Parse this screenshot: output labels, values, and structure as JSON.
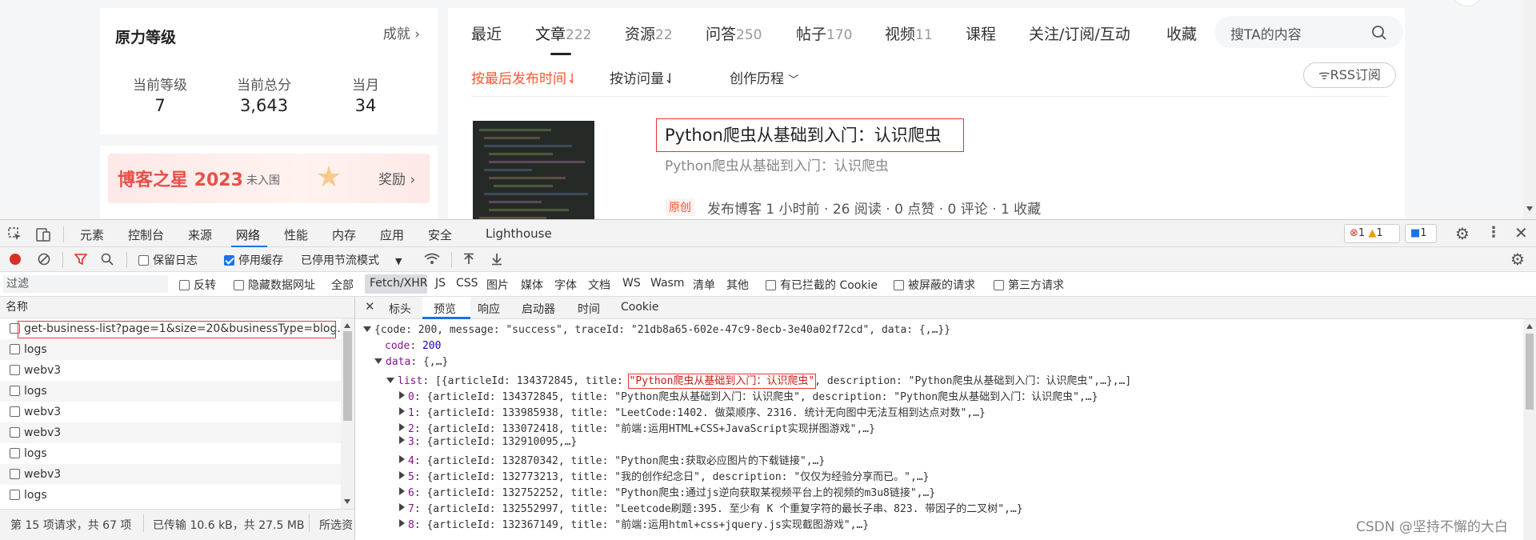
{
  "profile": {
    "level_title": "原力等级",
    "achievements_link": "成就",
    "stats": [
      {
        "label": "当前等级",
        "value": "7"
      },
      {
        "label": "当前总分",
        "value": "3,643"
      },
      {
        "label": "当月",
        "value": "34"
      }
    ]
  },
  "banner": {
    "title": "博客之星 2023",
    "status": "未入围",
    "reward": "奖励"
  },
  "tabs": [
    {
      "label": "最近",
      "count": ""
    },
    {
      "label": "文章",
      "count": "222"
    },
    {
      "label": "资源",
      "count": "22"
    },
    {
      "label": "问答",
      "count": "250"
    },
    {
      "label": "帖子",
      "count": "170"
    },
    {
      "label": "视频",
      "count": "11"
    },
    {
      "label": "课程",
      "count": ""
    },
    {
      "label": "关注/订阅/互动",
      "count": ""
    },
    {
      "label": "收藏",
      "count": ""
    }
  ],
  "search": {
    "placeholder": "搜TA的内容"
  },
  "sort": {
    "by_time": "按最后发布时间",
    "by_views": "按访问量",
    "history": "创作历程",
    "rss": "RSS订阅"
  },
  "article": {
    "title": "Python爬虫从基础到入门：认识爬虫",
    "description": "Python爬虫从基础到入门：认识爬虫",
    "badge": "原创",
    "meta": "发布博客 1 小时前 ·  26 阅读 ·  0 点赞 ·  0 评论 ·  1 收藏"
  },
  "devtools": {
    "tabs": [
      "元素",
      "控制台",
      "来源",
      "网络",
      "性能",
      "内存",
      "应用",
      "安全",
      "Lighthouse"
    ],
    "active_tab": "网络",
    "errors": "1",
    "warnings": "1",
    "messages": "1",
    "toolbar": {
      "preserve_log": "保留日志",
      "disable_cache": "停用缓存",
      "throttling": "已停用节流模式"
    },
    "filter": {
      "placeholder": "过滤",
      "invert": "反转",
      "hide_data_urls": "隐藏数据网址",
      "types": [
        "全部",
        "Fetch/XHR",
        "JS",
        "CSS",
        "图片",
        "媒体",
        "字体",
        "文档",
        "WS",
        "Wasm",
        "清单",
        "其他"
      ],
      "active_type": "Fetch/XHR",
      "blocked_cookies": "有已拦截的 Cookie",
      "blocked_requests": "被屏蔽的请求",
      "third_party": "第三方请求"
    },
    "name_header": "名称",
    "requests": [
      "get-business-list?page=1&size=20&businessType=blog...y",
      "logs",
      "webv3",
      "logs",
      "webv3",
      "webv3",
      "logs",
      "webv3",
      "logs"
    ],
    "detail_tabs": [
      "标头",
      "预览",
      "响应",
      "启动器",
      "时间",
      "Cookie"
    ],
    "active_detail_tab": "预览",
    "status_bar": {
      "requests": "第 15 项请求，共 67 项",
      "transferred": "已传输 10.6 kB，共 27.5 MB",
      "selected": "所选资"
    },
    "preview": {
      "root": "{code: 200, message: \"success\", traceId: \"21db8a65-602e-47c9-8ecb-3e40a02f72cd\", data: {,…}}",
      "code_key": "code",
      "code_val": "200",
      "data_key": "data",
      "data_val": "{,…}",
      "list_key": "list",
      "list_prefix": "[{articleId: 134372845, title: ",
      "list_title": "\"Python爬虫从基础到入门：认识爬虫\"",
      "list_suffix": ", description: \"Python爬虫从基础到入门：认识爬虫\",…},…]",
      "items": [
        {
          "idx": "0",
          "body": "{articleId: 134372845, title: \"Python爬虫从基础到入门：认识爬虫\", description: \"Python爬虫从基础到入门：认识爬虫\",…}"
        },
        {
          "idx": "1",
          "body": "{articleId: 133985938, title: \"LeetCode:1402. 做菜顺序、2316. 统计无向图中无法互相到达点对数\",…}"
        },
        {
          "idx": "2",
          "body": "{articleId: 133072418, title: \"前端:运用HTML+CSS+JavaScript实现拼图游戏\",…}"
        },
        {
          "idx": "3",
          "body": "{articleId: 132910095,…}"
        },
        {
          "idx": "4",
          "body": "{articleId: 132870342, title: \"Python爬虫:获取必应图片的下载链接\",…}"
        },
        {
          "idx": "5",
          "body": "{articleId: 132773213, title: \"我的创作纪念日\", description: \"仅仅为经验分享而已。\",…}"
        },
        {
          "idx": "6",
          "body": "{articleId: 132752252, title: \"Python爬虫:通过js逆向获取某视频平台上的视频的m3u8链接\",…}"
        },
        {
          "idx": "7",
          "body": "{articleId: 132552997, title: \"Leetcode刷题:395. 至少有 K 个重复字符的最长子串、823. 带因子的二叉树\",…}"
        },
        {
          "idx": "8",
          "body": "{articleId: 132367149, title: \"前端:运用html+css+jquery.js实现截图游戏\",…}"
        }
      ]
    },
    "watermark": "CSDN @坚持不懈的大白"
  }
}
